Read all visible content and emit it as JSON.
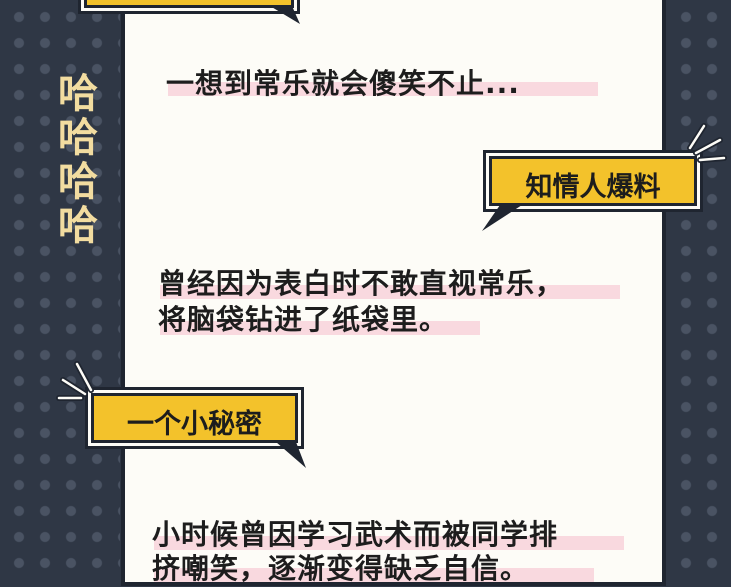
{
  "side_laugh": [
    "哈",
    "哈",
    "哈",
    "哈"
  ],
  "section1": {
    "text": "一想到常乐就会傻笑不止..."
  },
  "section2": {
    "tag": "知情人爆料",
    "lines": [
      "曾经因为表白时不敢直视常乐，",
      "将脑袋钻进了纸袋里。"
    ]
  },
  "section3": {
    "tag": "一个小秘密",
    "lines": [
      "小时候曾因学习武术而被同学排",
      "挤嘲笑，逐渐变得缺乏自信。"
    ]
  },
  "colors": {
    "background": "#2f3745",
    "panel": "#fdfcf7",
    "tag_yellow": "#f3c22b",
    "highlight_pink": "#f9d9df",
    "laugh_text": "#f2dca0"
  }
}
